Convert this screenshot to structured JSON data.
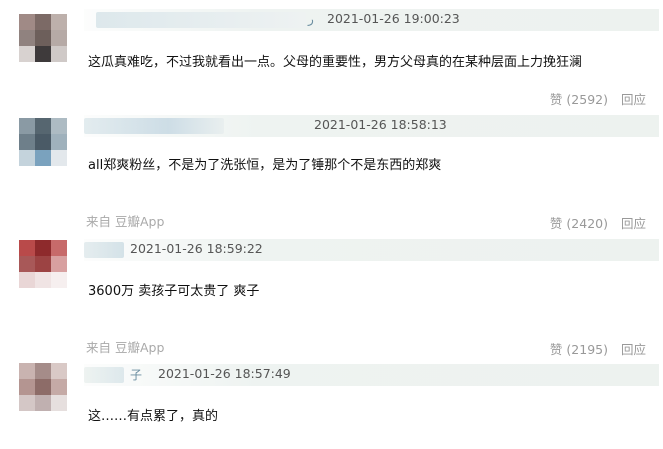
{
  "comments": [
    {
      "time": "2021-01-26 19:00:23",
      "name_fragment": "ر",
      "content": "这瓜真难吃，不过我就看出一点。父母的重要性，男方父母真的在某种层面上力挽狂澜",
      "source": "",
      "like_label": "赞",
      "like_count": "(2592)",
      "reply_label": "回应"
    },
    {
      "time": "2021-01-26 18:58:13",
      "name_fragment": "",
      "content": "all郑爽粉丝，不是为了洗张恒，是为了锤那个不是东西的郑爽",
      "source": "来自 豆瓣App",
      "like_label": "赞",
      "like_count": "(2420)",
      "reply_label": "回应"
    },
    {
      "time": "2021-01-26 18:59:22",
      "name_fragment": "",
      "content": "3600万 卖孩子可太贵了 爽子",
      "source": "来自 豆瓣App",
      "like_label": "赞",
      "like_count": "(2195)",
      "reply_label": "回应"
    },
    {
      "time": "2021-01-26 18:57:49",
      "name_fragment": "子",
      "content": "这……有点累了，真的",
      "source": "",
      "like_label": "",
      "like_count": "",
      "reply_label": ""
    }
  ],
  "colors": {
    "header_bg": "#eef3f1",
    "time_text": "#555555",
    "muted_text": "#999999",
    "source_text": "#a9a9a9"
  }
}
